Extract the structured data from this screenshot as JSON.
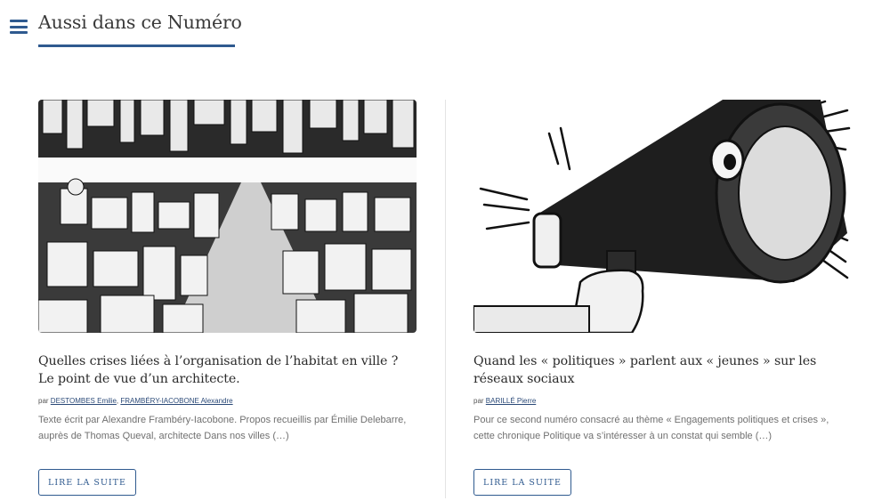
{
  "section": {
    "title": "Aussi dans ce Numéro"
  },
  "articles": [
    {
      "title": "Quelles crises liées à l’organisation de l’habitat en ville ? Le point de vue d’un architecte.",
      "by_prefix": "par",
      "authors": [
        "DESTOMBES Emilie",
        "FRAMBÉRY-IACOBONE Alexandre"
      ],
      "excerpt": "Texte écrit par Alexandre Frambéry-Iacobone. Propos recueillis par Émilie Delebarre, auprès de Thomas Queval, architecte Dans nos villes (…)",
      "button": "LIRE LA SUITE",
      "image": "city-architecture-illustration"
    },
    {
      "title": "Quand les « politiques » parlent aux « jeunes » sur les réseaux sociaux",
      "by_prefix": "par",
      "authors": [
        "BARILLÉ Pierre"
      ],
      "excerpt": "Pour ce second numéro consacré au thème « Engagements politiques et crises », cette chronique Politique va s’intéresser à un constat qui semble (…)",
      "button": "LIRE LA SUITE",
      "image": "megaphone-illustration"
    }
  ],
  "icons": {
    "menu": "hamburger-menu-icon"
  },
  "colors": {
    "accent": "#2f5a8f",
    "text": "#2b2b2b",
    "muted": "#707070"
  }
}
